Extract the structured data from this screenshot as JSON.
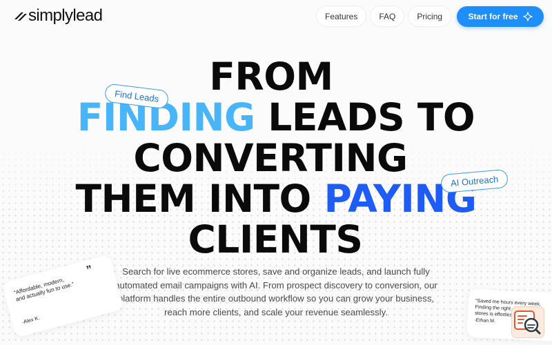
{
  "brand": {
    "name": "simplylead",
    "logo_icon": "slash-logo-icon"
  },
  "nav": {
    "items": [
      "Features",
      "FAQ",
      "Pricing"
    ]
  },
  "cta": {
    "label": "Start for free",
    "icon": "sparkle-icon"
  },
  "hero": {
    "line1": "FROM",
    "line2_highlight": "FINDING",
    "line2_rest": " LEADS TO",
    "line3": "CONVERTING",
    "line4_start": "THEM INTO ",
    "line4_highlight": "PAYING",
    "line5": "CLIENTS",
    "tag_left": "Find Leads",
    "tag_right": "AI Outreach",
    "subtitle_lines": [
      "Search for live ecommerce stores, save and organize leads, and launch fully",
      "automated email campaigns with AI. From prospect discovery to conversion, our",
      "platform handles the entire outbound workflow so you can grow your business,",
      "reach more clients, and scale your revenue seamlessly."
    ]
  },
  "testimonials": [
    {
      "quote_lines": [
        "“Affordable, modern,",
        "and actually fun to use.”"
      ],
      "author": "-Alex K."
    },
    {
      "quote_lines": [
        "“Saved me hours every week.",
        "Finding the right",
        "stores is effortless.”"
      ],
      "author": "-Ethan M."
    }
  ],
  "colors": {
    "accent": "#1e8ff8",
    "highlight_light": "#47b5f7",
    "highlight_blue": "#1f5cf5"
  }
}
